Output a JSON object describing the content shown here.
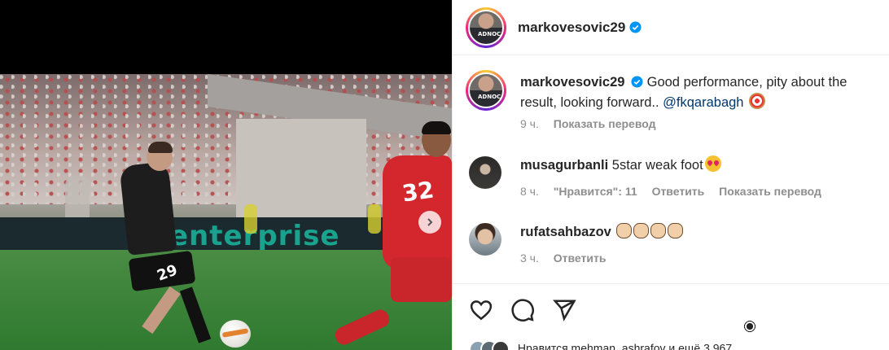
{
  "post": {
    "author": "markovesovic29",
    "header_username": "markovesovic29"
  },
  "icons": {
    "verified": "verified-badge-icon",
    "next": "chevron-right-icon",
    "like": "heart-icon",
    "comment": "comment-icon",
    "share": "share-icon"
  },
  "colors": {
    "verified": "#0095f6",
    "text": "#262626",
    "meta": "#8e8e8e",
    "mention": "#00376b"
  },
  "caption": {
    "username": "markovesovic29",
    "text": "Good performance, pity about the result, looking forward..",
    "mention": "@fkqarabagh",
    "time": "9 ч.",
    "translate": "Показать перевод"
  },
  "comments": [
    {
      "username": "musagurbanli",
      "text": "5star weak foot",
      "time": "8 ч.",
      "likes": "\"Нравится\": 11",
      "reply": "Ответить",
      "translate": "Показать перевод"
    },
    {
      "username": "rufatsahbazov",
      "text": "",
      "time": "3 ч.",
      "reply": "Ответить"
    }
  ],
  "media": {
    "adboard_text": "enterprise",
    "player_number_1": "29",
    "player_number_2": "32",
    "shirt_text_avatar": "ADNOC"
  },
  "likes_line": "Нравится mehman_ashrafov и ещё 3 967"
}
